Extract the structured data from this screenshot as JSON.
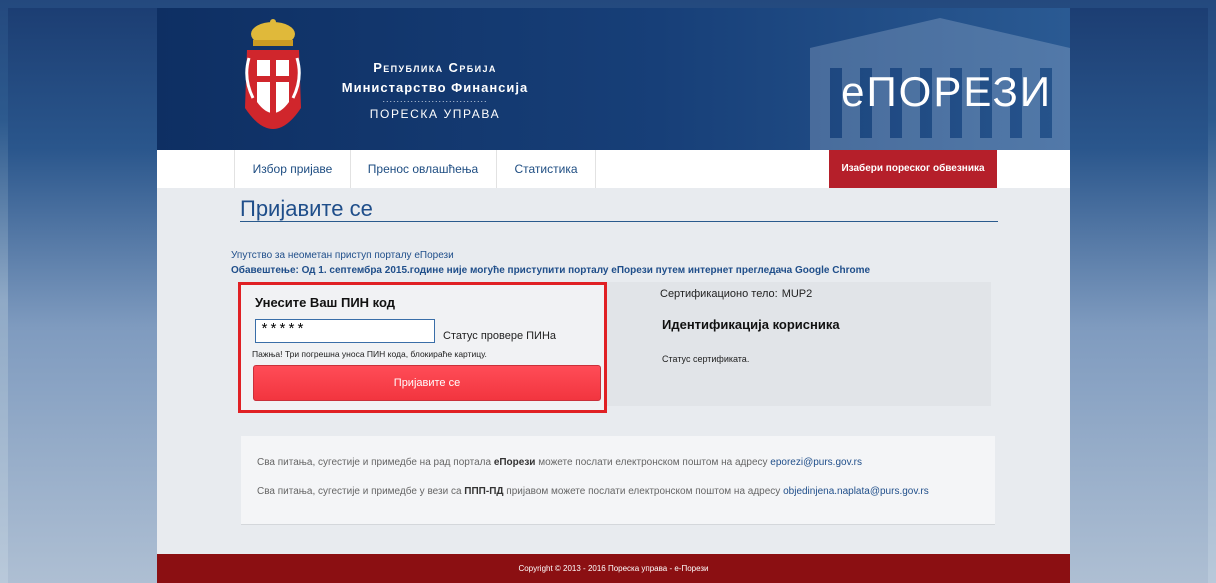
{
  "header": {
    "org_line1": "Република Србија",
    "org_line2": "Министарство Финансија",
    "org_line3": "ПОРЕСКА УПРАВА",
    "brand": "еПОРЕЗИ"
  },
  "nav": {
    "items": [
      "Избор пријаве",
      "Пренос овлашћења",
      "Статистика"
    ],
    "taxpayer_button": "Изабери пореског обвезника"
  },
  "page": {
    "title": "Пријавите се",
    "guide_link": "Упутство за неометан приступ порталу еПорези",
    "notice": "Обавештење: Од 1. септембра 2015.године није могуће приступити порталу еПорези путем интернет прегледача Google Chrome"
  },
  "pin": {
    "title": "Унесите Ваш ПИН код",
    "value": "*****",
    "status": "Статус провере ПИНа",
    "warning": "Пажња! Три погрешна уноса ПИН кода, блокираће картицу.",
    "login_button": "Пријавите се"
  },
  "cert": {
    "body_label": "Сертификационо тело:",
    "body_value": "MUP2",
    "ident_title": "Идентификација корисника",
    "status": "Статус сертификата."
  },
  "contact": {
    "line1_a": "Сва питања, сугестије и примедбе на рад портала ",
    "line1_b": "еПорези",
    "line1_c": " можете послати електронском поштом на адресу ",
    "line1_mail": "eporezi@purs.gov.rs",
    "line2_a": "Сва питања, сугестије и примедбе у вези са ",
    "line2_b": "ППП-ПД",
    "line2_c": " пријавом можете послати електронском поштом на адресу ",
    "line2_mail": "objedinjena.naplata@purs.gov.rs"
  },
  "footer": {
    "copyright": "Copyright © 2013 - 2016 Пореска управа - е-Порези"
  }
}
